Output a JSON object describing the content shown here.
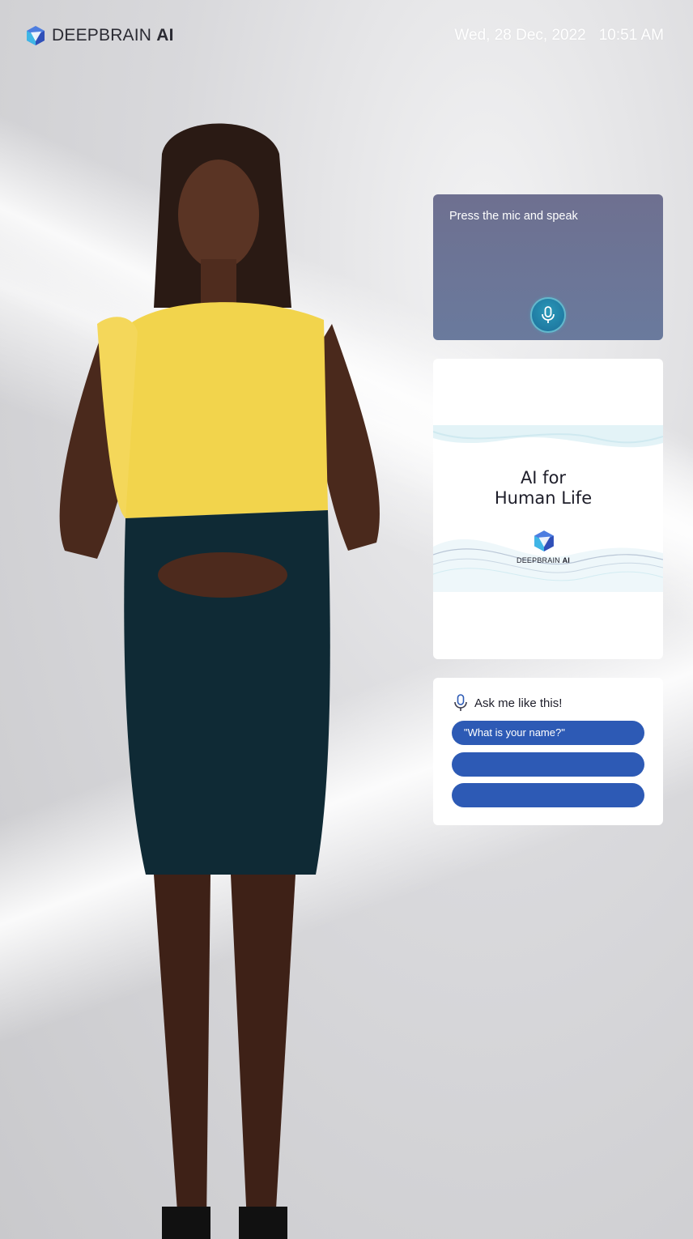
{
  "header": {
    "brand_name": "DEEPBRAIN",
    "brand_suffix": "AI",
    "date": "Wed, 28 Dec, 2022",
    "time": "10:51 AM"
  },
  "mic_panel": {
    "prompt": "Press the mic and speak",
    "mic_icon": "microphone-icon"
  },
  "content_panel": {
    "banner_title_line1": "AI for",
    "banner_title_line2": "Human Life",
    "brand_name": "DEEPBRAIN",
    "brand_suffix": "AI"
  },
  "suggestions": {
    "title": "Ask me like this!",
    "icon": "microphone-icon",
    "items": [
      "\"What is your name?\"",
      "",
      ""
    ]
  },
  "colors": {
    "suggestion_button": "#2d5ab5",
    "mic_panel": "#6e7090",
    "mic_button": "#1b6f9a"
  }
}
